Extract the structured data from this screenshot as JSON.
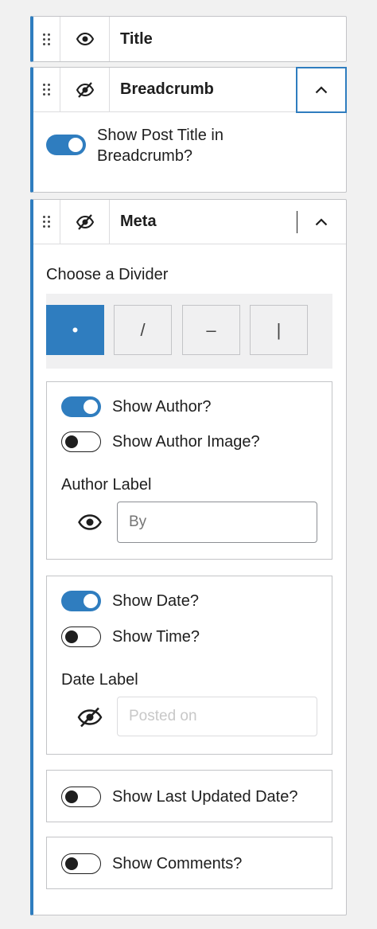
{
  "panels": {
    "title": {
      "label": "Title"
    },
    "breadcrumb": {
      "label": "Breadcrumb",
      "show_post_title_line1": "Show Post Title in",
      "show_post_title_line2": "Breadcrumb?"
    },
    "meta": {
      "label": "Meta",
      "divider_heading": "Choose a Divider",
      "dividers": [
        "•",
        "/",
        "–",
        "|"
      ],
      "selected_divider": "•",
      "author": {
        "show_author": "Show Author?",
        "show_author_image": "Show Author Image?",
        "label_heading": "Author Label",
        "placeholder": "By"
      },
      "date": {
        "show_date": "Show Date?",
        "show_time": "Show Time?",
        "label_heading": "Date Label",
        "placeholder": "Posted on"
      },
      "show_last_updated": "Show Last Updated Date?",
      "show_comments": "Show Comments?"
    }
  },
  "colors": {
    "accent": "#2f7dbf",
    "border": "#c3c4c7",
    "background": "#f1f1f1"
  },
  "icons": {
    "drag": "drag-handle-icon",
    "visible": "eye-icon",
    "hidden": "eye-slash-icon",
    "collapse": "chevron-up-icon"
  }
}
